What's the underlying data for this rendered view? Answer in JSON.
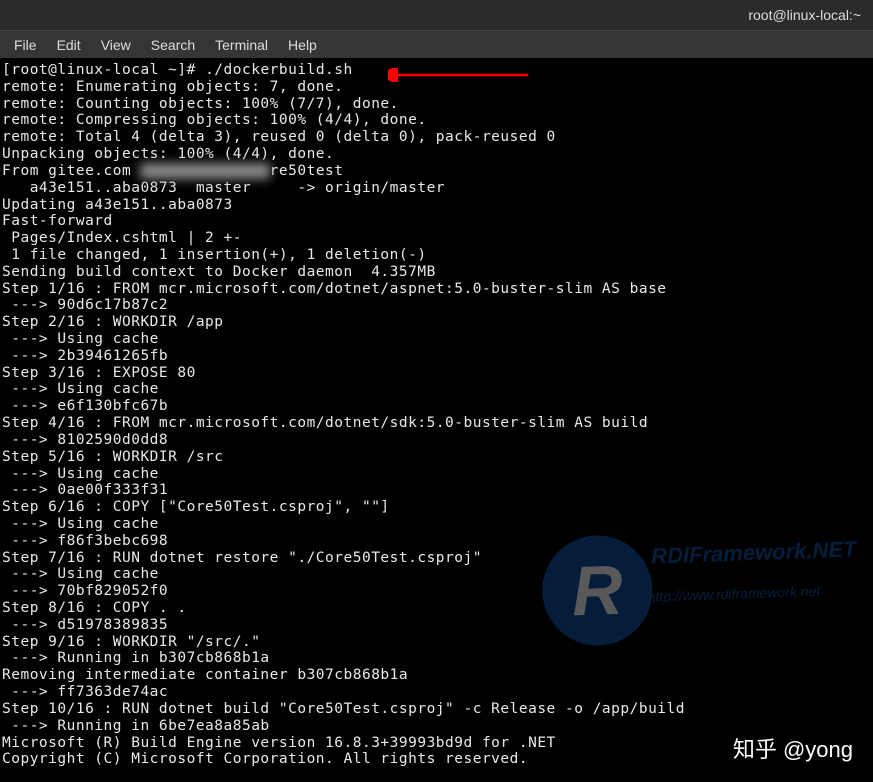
{
  "titlebar": {
    "title": "root@linux-local:~"
  },
  "menubar": {
    "items": [
      {
        "label": "File"
      },
      {
        "label": "Edit"
      },
      {
        "label": "View"
      },
      {
        "label": "Search"
      },
      {
        "label": "Terminal"
      },
      {
        "label": "Help"
      }
    ]
  },
  "terminal": {
    "prompt": "[root@linux-local ~]# ",
    "command": "./dockerbuild.sh",
    "lines": [
      "remote: Enumerating objects: 7, done.",
      "remote: Counting objects: 100% (7/7), done.",
      "remote: Compressing objects: 100% (4/4), done.",
      "remote: Total 4 (delta 3), reused 0 (delta 0), pack-reused 0",
      "Unpacking objects: 100% (4/4), done.",
      "From gitee.com ███████████████ re50test",
      "   a43e151..aba0873  master     -> origin/master",
      "Updating a43e151..aba0873",
      "Fast-forward",
      " Pages/Index.cshtml | 2 +-",
      " 1 file changed, 1 insertion(+), 1 deletion(-)",
      "Sending build context to Docker daemon  4.357MB",
      "Step 1/16 : FROM mcr.microsoft.com/dotnet/aspnet:5.0-buster-slim AS base",
      " ---> 90d6c17b87c2",
      "Step 2/16 : WORKDIR /app",
      " ---> Using cache",
      " ---> 2b39461265fb",
      "Step 3/16 : EXPOSE 80",
      " ---> Using cache",
      " ---> e6f130bfc67b",
      "Step 4/16 : FROM mcr.microsoft.com/dotnet/sdk:5.0-buster-slim AS build",
      " ---> 8102590d0dd8",
      "Step 5/16 : WORKDIR /src",
      " ---> Using cache",
      " ---> 0ae00f333f31",
      "Step 6/16 : COPY [\"Core50Test.csproj\", \"\"]",
      " ---> Using cache",
      " ---> f86f3bebc698",
      "Step 7/16 : RUN dotnet restore \"./Core50Test.csproj\"",
      " ---> Using cache",
      " ---> 70bf829052f0",
      "Step 8/16 : COPY . .",
      " ---> d51978389835",
      "Step 9/16 : WORKDIR \"/src/.\"",
      " ---> Running in b307cb868b1a",
      "Removing intermediate container b307cb868b1a",
      " ---> ff7363de74ac",
      "Step 10/16 : RUN dotnet build \"Core50Test.csproj\" -c Release -o /app/build",
      " ---> Running in 6be7ea8a85ab",
      "Microsoft (R) Build Engine version 16.8.3+39993bd9d for .NET",
      "Copyright (C) Microsoft Corporation. All rights reserved.",
      ""
    ]
  },
  "watermark": {
    "letter": "R",
    "text1": "RDIFramework",
    "text2": "http://www.rdiframework.net",
    "suffix": ".NET"
  },
  "zhihu": {
    "text": "知乎 @yong"
  }
}
